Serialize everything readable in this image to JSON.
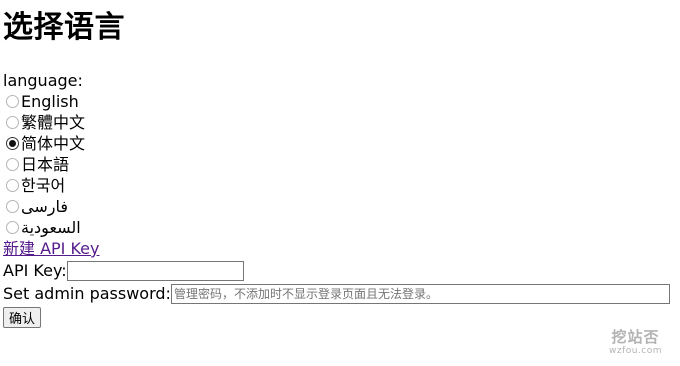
{
  "page": {
    "title": "选择语言",
    "language_label": "language:",
    "languages": [
      {
        "label": "English",
        "checked": false
      },
      {
        "label": "繁體中文",
        "checked": false
      },
      {
        "label": "简体中文",
        "checked": true
      },
      {
        "label": "日本語",
        "checked": false
      },
      {
        "label": "한국어",
        "checked": false
      },
      {
        "label": "فارسی",
        "checked": false
      },
      {
        "label": "السعودية",
        "checked": false
      }
    ],
    "new_api_key_link": "新建 API Key",
    "api_key": {
      "label": "API Key:",
      "value": "",
      "placeholder": ""
    },
    "admin_password": {
      "label": "Set admin password:",
      "value": "",
      "placeholder": "管理密码，不添加时不显示登录页面且无法登录。"
    },
    "confirm_button": "确认"
  },
  "watermark": {
    "main": "挖站否",
    "sub": "wzfou.com"
  }
}
